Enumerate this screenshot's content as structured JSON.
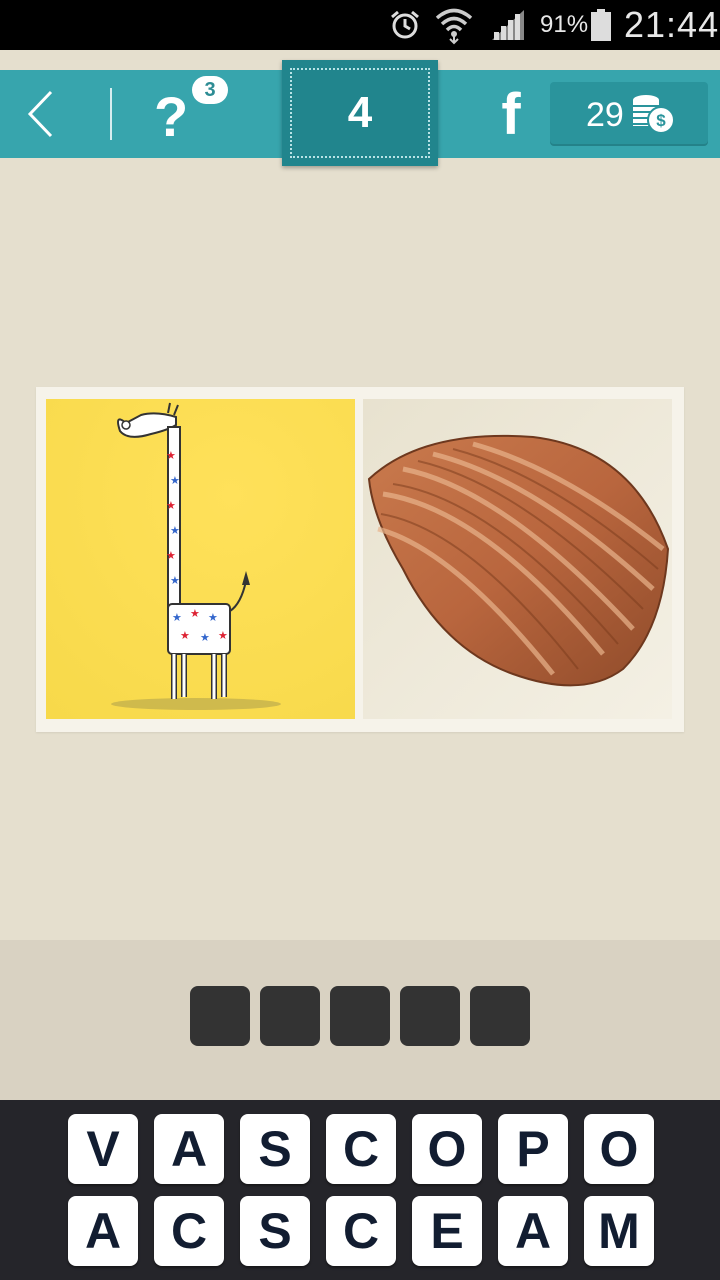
{
  "status_bar": {
    "battery_percent": "91%",
    "clock": "21:44",
    "icons": [
      "alarm-icon",
      "wifi-icon",
      "signal-icon",
      "battery-icon"
    ]
  },
  "top_bar": {
    "help_symbol": "?",
    "hints_badge": "3",
    "level": "4",
    "facebook_symbol": "f",
    "coins": "29"
  },
  "puzzle": {
    "images": [
      "giraffe-drawing",
      "seashell-photo"
    ]
  },
  "answer": {
    "slot_count": 5
  },
  "keyboard": {
    "row1": [
      "V",
      "A",
      "S",
      "C",
      "O",
      "P",
      "O"
    ],
    "row2": [
      "A",
      "C",
      "S",
      "C",
      "E",
      "A",
      "M"
    ]
  },
  "colors": {
    "accent": "#37a5ad",
    "accent_dark": "#21858d",
    "background": "#e5dfce",
    "keyboard_bg": "#25252a",
    "slot": "#333333"
  }
}
